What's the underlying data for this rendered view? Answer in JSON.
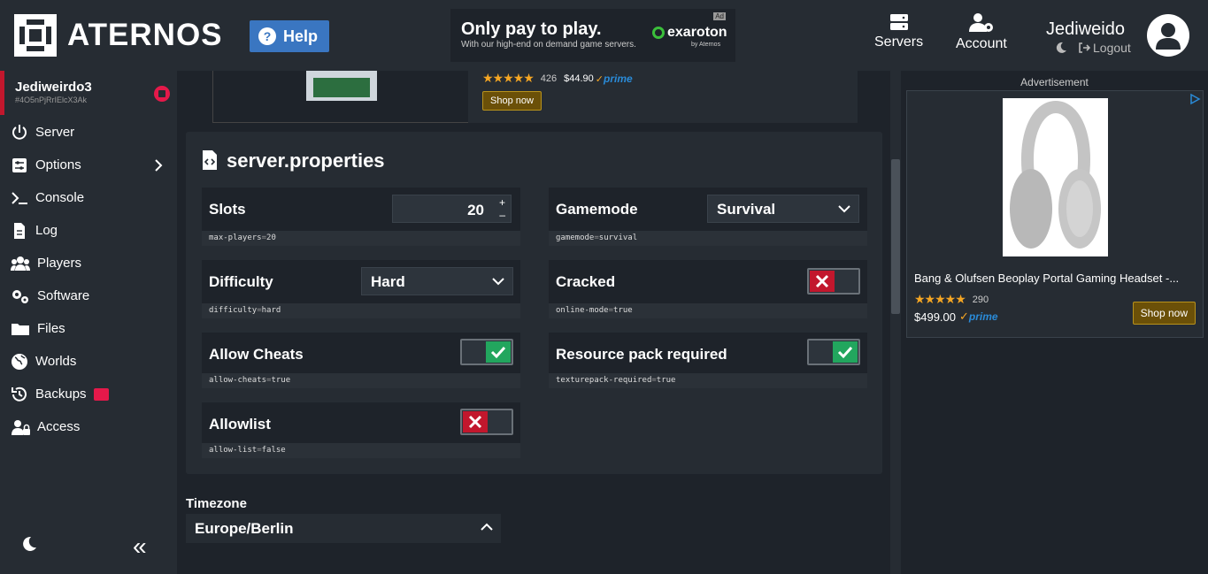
{
  "header": {
    "logo_text": "ATERNOS",
    "help_label": "Help",
    "top_ad": {
      "title": "Only pay to play.",
      "subtitle": "With our high-end on demand game servers.",
      "badge": "Ad",
      "brand": "exaroton",
      "brand_sub": "by Aternos"
    },
    "nav": [
      {
        "label": "Servers",
        "icon": "servers-icon"
      },
      {
        "label": "Account",
        "icon": "account-icon"
      }
    ],
    "user": {
      "name": "Jediweido",
      "logout_label": "Logout"
    }
  },
  "sidebar": {
    "server_name": "Jediweirdo3",
    "server_id": "#4O5nPjRrIElcX3Ak",
    "items": [
      {
        "label": "Server",
        "icon": "power-icon"
      },
      {
        "label": "Options",
        "icon": "options-icon"
      },
      {
        "label": "Console",
        "icon": "console-icon"
      },
      {
        "label": "Log",
        "icon": "log-icon"
      },
      {
        "label": "Players",
        "icon": "players-icon"
      },
      {
        "label": "Software",
        "icon": "software-icon"
      },
      {
        "label": "Files",
        "icon": "folder-icon"
      },
      {
        "label": "Worlds",
        "icon": "globe-icon"
      },
      {
        "label": "Backups",
        "icon": "backups-icon"
      },
      {
        "label": "Access",
        "icon": "access-icon"
      }
    ]
  },
  "main_ad": {
    "rating_count": "426",
    "price": "$44.90",
    "prime": "prime",
    "shop_label": "Shop now"
  },
  "properties": {
    "title": "server.properties",
    "items": {
      "slots": {
        "label": "Slots",
        "value": "20",
        "key": "max-players",
        "key_value": "20"
      },
      "gamemode": {
        "label": "Gamemode",
        "value": "Survival",
        "key": "gamemode",
        "key_value": "survival"
      },
      "difficulty": {
        "label": "Difficulty",
        "value": "Hard",
        "key": "difficulty",
        "key_value": "hard"
      },
      "cracked": {
        "label": "Cracked",
        "state": "off",
        "key": "online-mode",
        "key_value": "true"
      },
      "allow_cheats": {
        "label": "Allow Cheats",
        "state": "on",
        "key": "allow-cheats",
        "key_value": "true"
      },
      "resource_pack": {
        "label": "Resource pack required",
        "state": "on",
        "key": "texturepack-required",
        "key_value": "true"
      },
      "allowlist": {
        "label": "Allowlist",
        "state": "off",
        "key": "allow-list",
        "key_value": "false"
      }
    }
  },
  "timezone": {
    "label": "Timezone",
    "value": "Europe/Berlin"
  },
  "right_ad": {
    "label": "Advertisement",
    "product": "Bang & Olufsen Beoplay Portal Gaming Headset -...",
    "rating_count": "290",
    "price": "$499.00",
    "prime": "prime",
    "shop_label": "Shop now"
  },
  "colors": {
    "accent_blue": "#3a76c1",
    "toggle_on": "#22a65e",
    "toggle_off": "#c2172d",
    "stop_red": "#e5194a"
  }
}
